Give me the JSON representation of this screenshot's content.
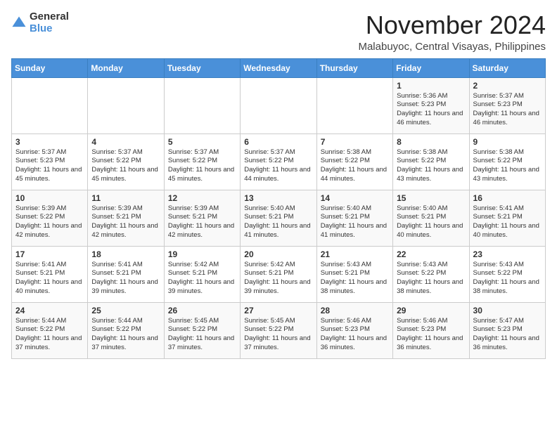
{
  "logo": {
    "general": "General",
    "blue": "Blue"
  },
  "header": {
    "month": "November 2024",
    "location": "Malabuyoc, Central Visayas, Philippines"
  },
  "weekdays": [
    "Sunday",
    "Monday",
    "Tuesday",
    "Wednesday",
    "Thursday",
    "Friday",
    "Saturday"
  ],
  "weeks": [
    [
      {
        "day": "",
        "info": ""
      },
      {
        "day": "",
        "info": ""
      },
      {
        "day": "",
        "info": ""
      },
      {
        "day": "",
        "info": ""
      },
      {
        "day": "",
        "info": ""
      },
      {
        "day": "1",
        "info": "Sunrise: 5:36 AM\nSunset: 5:23 PM\nDaylight: 11 hours and 46 minutes."
      },
      {
        "day": "2",
        "info": "Sunrise: 5:37 AM\nSunset: 5:23 PM\nDaylight: 11 hours and 46 minutes."
      }
    ],
    [
      {
        "day": "3",
        "info": "Sunrise: 5:37 AM\nSunset: 5:23 PM\nDaylight: 11 hours and 45 minutes."
      },
      {
        "day": "4",
        "info": "Sunrise: 5:37 AM\nSunset: 5:22 PM\nDaylight: 11 hours and 45 minutes."
      },
      {
        "day": "5",
        "info": "Sunrise: 5:37 AM\nSunset: 5:22 PM\nDaylight: 11 hours and 45 minutes."
      },
      {
        "day": "6",
        "info": "Sunrise: 5:37 AM\nSunset: 5:22 PM\nDaylight: 11 hours and 44 minutes."
      },
      {
        "day": "7",
        "info": "Sunrise: 5:38 AM\nSunset: 5:22 PM\nDaylight: 11 hours and 44 minutes."
      },
      {
        "day": "8",
        "info": "Sunrise: 5:38 AM\nSunset: 5:22 PM\nDaylight: 11 hours and 43 minutes."
      },
      {
        "day": "9",
        "info": "Sunrise: 5:38 AM\nSunset: 5:22 PM\nDaylight: 11 hours and 43 minutes."
      }
    ],
    [
      {
        "day": "10",
        "info": "Sunrise: 5:39 AM\nSunset: 5:22 PM\nDaylight: 11 hours and 42 minutes."
      },
      {
        "day": "11",
        "info": "Sunrise: 5:39 AM\nSunset: 5:21 PM\nDaylight: 11 hours and 42 minutes."
      },
      {
        "day": "12",
        "info": "Sunrise: 5:39 AM\nSunset: 5:21 PM\nDaylight: 11 hours and 42 minutes."
      },
      {
        "day": "13",
        "info": "Sunrise: 5:40 AM\nSunset: 5:21 PM\nDaylight: 11 hours and 41 minutes."
      },
      {
        "day": "14",
        "info": "Sunrise: 5:40 AM\nSunset: 5:21 PM\nDaylight: 11 hours and 41 minutes."
      },
      {
        "day": "15",
        "info": "Sunrise: 5:40 AM\nSunset: 5:21 PM\nDaylight: 11 hours and 40 minutes."
      },
      {
        "day": "16",
        "info": "Sunrise: 5:41 AM\nSunset: 5:21 PM\nDaylight: 11 hours and 40 minutes."
      }
    ],
    [
      {
        "day": "17",
        "info": "Sunrise: 5:41 AM\nSunset: 5:21 PM\nDaylight: 11 hours and 40 minutes."
      },
      {
        "day": "18",
        "info": "Sunrise: 5:41 AM\nSunset: 5:21 PM\nDaylight: 11 hours and 39 minutes."
      },
      {
        "day": "19",
        "info": "Sunrise: 5:42 AM\nSunset: 5:21 PM\nDaylight: 11 hours and 39 minutes."
      },
      {
        "day": "20",
        "info": "Sunrise: 5:42 AM\nSunset: 5:21 PM\nDaylight: 11 hours and 39 minutes."
      },
      {
        "day": "21",
        "info": "Sunrise: 5:43 AM\nSunset: 5:21 PM\nDaylight: 11 hours and 38 minutes."
      },
      {
        "day": "22",
        "info": "Sunrise: 5:43 AM\nSunset: 5:22 PM\nDaylight: 11 hours and 38 minutes."
      },
      {
        "day": "23",
        "info": "Sunrise: 5:43 AM\nSunset: 5:22 PM\nDaylight: 11 hours and 38 minutes."
      }
    ],
    [
      {
        "day": "24",
        "info": "Sunrise: 5:44 AM\nSunset: 5:22 PM\nDaylight: 11 hours and 37 minutes."
      },
      {
        "day": "25",
        "info": "Sunrise: 5:44 AM\nSunset: 5:22 PM\nDaylight: 11 hours and 37 minutes."
      },
      {
        "day": "26",
        "info": "Sunrise: 5:45 AM\nSunset: 5:22 PM\nDaylight: 11 hours and 37 minutes."
      },
      {
        "day": "27",
        "info": "Sunrise: 5:45 AM\nSunset: 5:22 PM\nDaylight: 11 hours and 37 minutes."
      },
      {
        "day": "28",
        "info": "Sunrise: 5:46 AM\nSunset: 5:23 PM\nDaylight: 11 hours and 36 minutes."
      },
      {
        "day": "29",
        "info": "Sunrise: 5:46 AM\nSunset: 5:23 PM\nDaylight: 11 hours and 36 minutes."
      },
      {
        "day": "30",
        "info": "Sunrise: 5:47 AM\nSunset: 5:23 PM\nDaylight: 11 hours and 36 minutes."
      }
    ]
  ]
}
